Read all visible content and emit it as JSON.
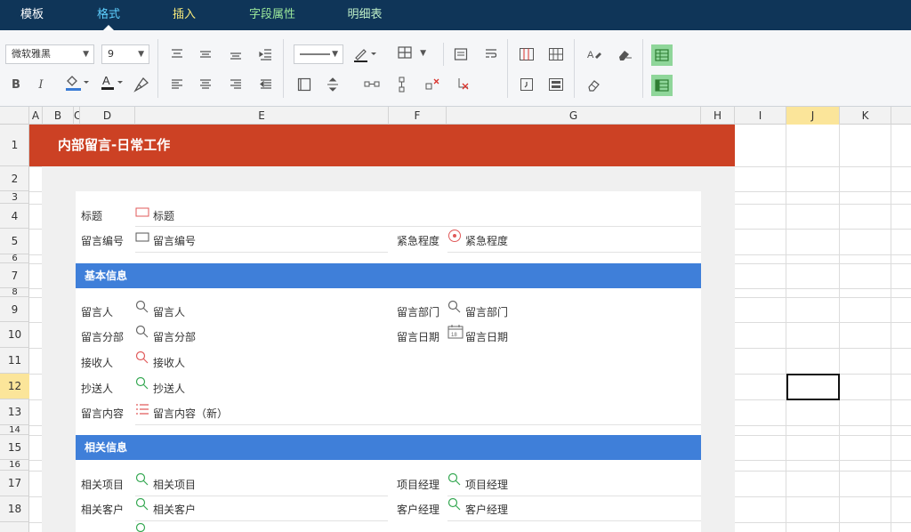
{
  "nav": {
    "tabs": [
      "模板",
      "格式",
      "插入",
      "字段属性",
      "明细表"
    ],
    "active": "格式"
  },
  "toolbar": {
    "font_family": "微软雅黑",
    "font_size": "9"
  },
  "sheet": {
    "columns": [
      "A",
      "B",
      "C",
      "D",
      "E",
      "F",
      "G",
      "H",
      "I",
      "J",
      "K"
    ],
    "rows": [
      "1",
      "2",
      "3",
      "4",
      "5",
      "6",
      "7",
      "8",
      "9",
      "10",
      "11",
      "12",
      "13",
      "14",
      "15",
      "16",
      "17",
      "18"
    ],
    "selected_column": "J",
    "selected_row": "12"
  },
  "form": {
    "title": "内部留言-日常工作",
    "row4": {
      "label": "标题",
      "value": "标题"
    },
    "row5": {
      "label": "留言编号",
      "value": "留言编号",
      "label2": "紧急程度",
      "value2": "紧急程度"
    },
    "section1": "基本信息",
    "row9": {
      "label": "留言人",
      "value": "留言人",
      "label2": "留言部门",
      "value2": "留言部门"
    },
    "row10": {
      "label": "留言分部",
      "value": "留言分部",
      "label2": "留言日期",
      "value2": "留言日期"
    },
    "row11": {
      "label": "接收人",
      "value": "接收人"
    },
    "row12": {
      "label": "抄送人",
      "value": "抄送人"
    },
    "row13": {
      "label": "留言内容",
      "value": "留言内容（新）"
    },
    "section2": "相关信息",
    "row17": {
      "label": "相关项目",
      "value": "相关项目",
      "label2": "项目经理",
      "value2": "项目经理"
    },
    "row18": {
      "label": "相关客户",
      "value": "相关客户",
      "label2": "客户经理",
      "value2": "客户经理"
    }
  }
}
